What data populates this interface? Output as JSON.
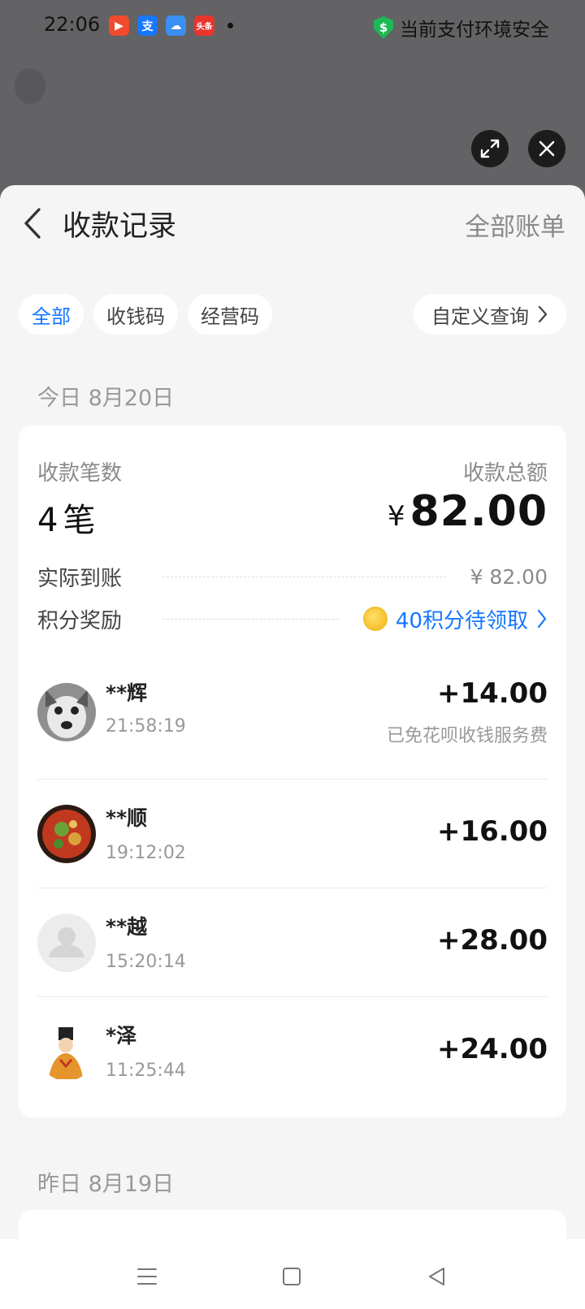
{
  "status_bar": {
    "time": "22:06",
    "apps": [
      {
        "icon": "video-app-icon",
        "glyph": "▶",
        "color": "#f04b2c"
      },
      {
        "icon": "alipay-app-icon",
        "glyph": "支",
        "color": "#1677ff"
      },
      {
        "icon": "weather-app-icon",
        "glyph": "☁",
        "color": "#3a8ff2"
      },
      {
        "icon": "toutiao-app-icon",
        "glyph": "头条",
        "color": "#e8352d"
      }
    ],
    "security_badge": "$",
    "security_text": "当前支付环境安全"
  },
  "header": {
    "title": "收款记录",
    "all_bills": "全部账单"
  },
  "filters": {
    "all": "全部",
    "qr_code": "收钱码",
    "business_code": "经营码",
    "custom_query": "自定义查询"
  },
  "today": {
    "date_label": "今日 8月20日",
    "count_label": "收款笔数",
    "count_value": "4",
    "count_unit": "笔",
    "total_label": "收款总额",
    "total_currency": "¥",
    "total_value": "82.00",
    "received_label": "实际到账",
    "received_value": "¥ 82.00",
    "points_label": "积分奖励",
    "points_value": "40积分待领取",
    "transactions": [
      {
        "name": "**辉",
        "time": "21:58:19",
        "amount": "+14.00",
        "note": "已免花呗收钱服务费"
      },
      {
        "name": "**顺",
        "time": "19:12:02",
        "amount": "+16.00"
      },
      {
        "name": "**越",
        "time": "15:20:14",
        "amount": "+28.00"
      },
      {
        "name": "*泽",
        "time": "11:25:44",
        "amount": "+24.00"
      }
    ]
  },
  "yesterday": {
    "date_label": "昨日 8月19日"
  },
  "colors": {
    "accent": "#1677ff",
    "secure": "#1db954",
    "coin": "#f3b51a"
  }
}
